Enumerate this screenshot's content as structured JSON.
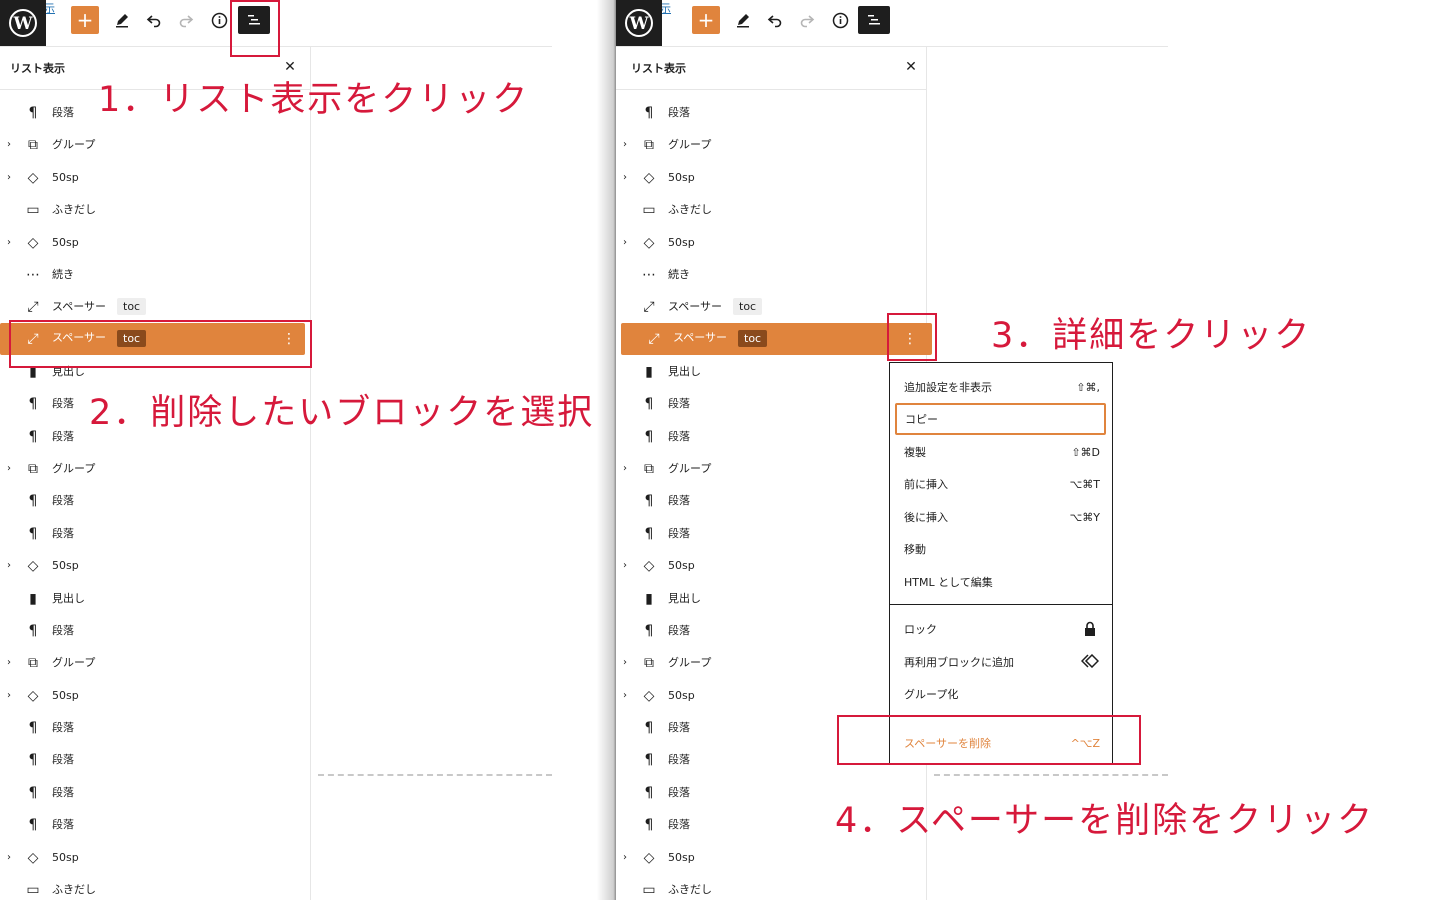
{
  "toolbar": {
    "add_icon": "plus",
    "view_post_link": "投稿を表示"
  },
  "listview": {
    "title": "リスト表示",
    "rows": [
      {
        "label": "段落",
        "icon": "¶",
        "expandable": false
      },
      {
        "label": "グループ",
        "icon": "⧉",
        "expandable": true
      },
      {
        "label": "50sp",
        "icon": "◇",
        "expandable": true
      },
      {
        "label": "ふきだし",
        "icon": "▭",
        "expandable": false
      },
      {
        "label": "50sp",
        "icon": "◇",
        "expandable": true
      },
      {
        "label": "続き",
        "icon": "⋯",
        "expandable": false
      },
      {
        "label": "スペーサー",
        "icon": "⤢",
        "badge": "toc",
        "expandable": false
      },
      {
        "label": "スペーサー",
        "icon": "⤢",
        "badge": "toc",
        "expandable": false,
        "selected": true
      },
      {
        "label": "見出し",
        "icon": "▮",
        "expandable": false
      },
      {
        "label": "段落",
        "icon": "¶",
        "expandable": false
      },
      {
        "label": "段落",
        "icon": "¶",
        "expandable": false
      },
      {
        "label": "グループ",
        "icon": "⧉",
        "expandable": true
      },
      {
        "label": "段落",
        "icon": "¶",
        "expandable": false
      },
      {
        "label": "段落",
        "icon": "¶",
        "expandable": false
      },
      {
        "label": "50sp",
        "icon": "◇",
        "expandable": true
      },
      {
        "label": "見出し",
        "icon": "▮",
        "expandable": false
      },
      {
        "label": "段落",
        "icon": "¶",
        "expandable": false
      },
      {
        "label": "グループ",
        "icon": "⧉",
        "expandable": true
      },
      {
        "label": "50sp",
        "icon": "◇",
        "expandable": true
      },
      {
        "label": "段落",
        "icon": "¶",
        "expandable": false
      },
      {
        "label": "段落",
        "icon": "¶",
        "expandable": false
      },
      {
        "label": "段落",
        "icon": "¶",
        "expandable": false
      },
      {
        "label": "段落",
        "icon": "¶",
        "expandable": false
      },
      {
        "label": "50sp",
        "icon": "◇",
        "expandable": true
      },
      {
        "label": "ふきだし",
        "icon": "▭",
        "expandable": false
      }
    ]
  },
  "menu": {
    "group1": [
      {
        "label": "追加設定を非表示",
        "shortcut": "⇧⌘,"
      },
      {
        "label": "コピー",
        "shortcut": "",
        "focused": true
      },
      {
        "label": "複製",
        "shortcut": "⇧⌘D"
      },
      {
        "label": "前に挿入",
        "shortcut": "⌥⌘T"
      },
      {
        "label": "後に挿入",
        "shortcut": "⌥⌘Y"
      },
      {
        "label": "移動",
        "shortcut": ""
      },
      {
        "label": "HTML として編集",
        "shortcut": ""
      }
    ],
    "group2": [
      {
        "label": "ロック",
        "icon": "lock-icon"
      },
      {
        "label": "再利用ブロックに追加",
        "icon": "reusable-block-icon"
      },
      {
        "label": "グループ化",
        "icon": ""
      }
    ],
    "delete": {
      "label": "スペーサーを削除",
      "shortcut": "^⌥Z"
    }
  },
  "annotations": {
    "step1": "1．リスト表示をクリック",
    "step2": "2．削除したいブロックを選択",
    "step3": "3．詳細をクリック",
    "step4": "4．スペーサーを削除をクリック"
  },
  "colors": {
    "accent": "#e0843d",
    "annotation": "#d6193b",
    "dark": "#1e1e1e"
  }
}
